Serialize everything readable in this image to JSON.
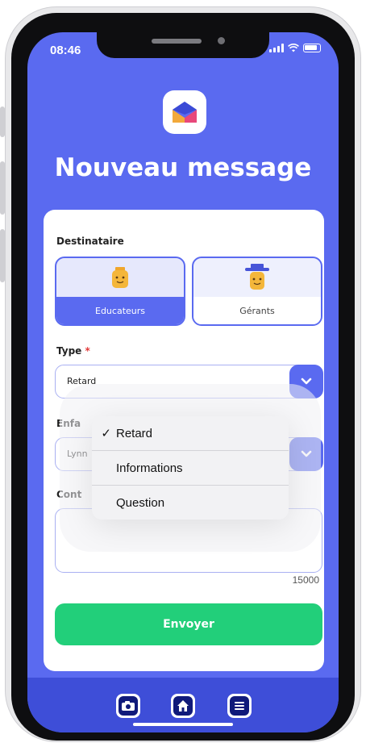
{
  "status": {
    "time": "08:46"
  },
  "header": {
    "title": "Nouveau message"
  },
  "form": {
    "recipient_label": "Destinataire",
    "recipients": [
      {
        "label": "Educateurs",
        "selected": true
      },
      {
        "label": "Gérants",
        "selected": false
      }
    ],
    "type_label": "Type",
    "required_mark": "*",
    "type_value": "Retard",
    "child_label": "Enfa",
    "child_value": "Lynn",
    "content_label": "Cont",
    "char_counter": "15000",
    "send_label": "Envoyer"
  },
  "dropdown": {
    "checkmark": "✓",
    "options": [
      {
        "label": "Retard",
        "selected": true
      },
      {
        "label": "Informations",
        "selected": false
      },
      {
        "label": "Question",
        "selected": false
      }
    ]
  },
  "tabbar": {
    "icons": [
      "camera-icon",
      "home-icon",
      "menu-icon"
    ]
  },
  "colors": {
    "primary": "#5a6af0",
    "tabbar": "#3e4ed8",
    "send": "#22cf7a",
    "required": "#e23a3a"
  }
}
